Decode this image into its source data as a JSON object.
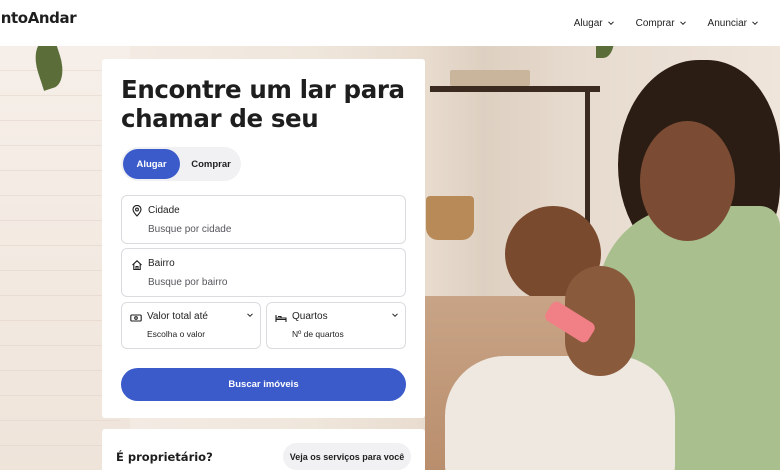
{
  "brand": {
    "name": "intoAndar"
  },
  "nav": {
    "items": [
      {
        "label": "Alugar"
      },
      {
        "label": "Comprar"
      },
      {
        "label": "Anunciar"
      }
    ]
  },
  "search_card": {
    "headline": "Encontre um lar para chamar de seu",
    "toggle": {
      "active": "Alugar",
      "inactive": "Comprar"
    },
    "fields": {
      "cidade": {
        "label": "Cidade",
        "placeholder": "Busque por cidade",
        "icon": "map-pin-icon"
      },
      "bairro": {
        "label": "Bairro",
        "placeholder": "Busque por bairro",
        "icon": "home-icon"
      },
      "valor": {
        "label": "Valor total até",
        "placeholder": "Escolha o valor",
        "icon": "money-icon"
      },
      "quartos": {
        "label": "Quartos",
        "placeholder": "Nº de quartos",
        "icon": "bed-icon"
      }
    },
    "submit_label": "Buscar imóveis"
  },
  "owner_bar": {
    "question": "É proprietário?",
    "button_label": "Veja os serviços para você"
  },
  "colors": {
    "primary": "#3b5bcb",
    "text": "#1f1f1f",
    "toggle_bg": "#f1f1f3"
  }
}
